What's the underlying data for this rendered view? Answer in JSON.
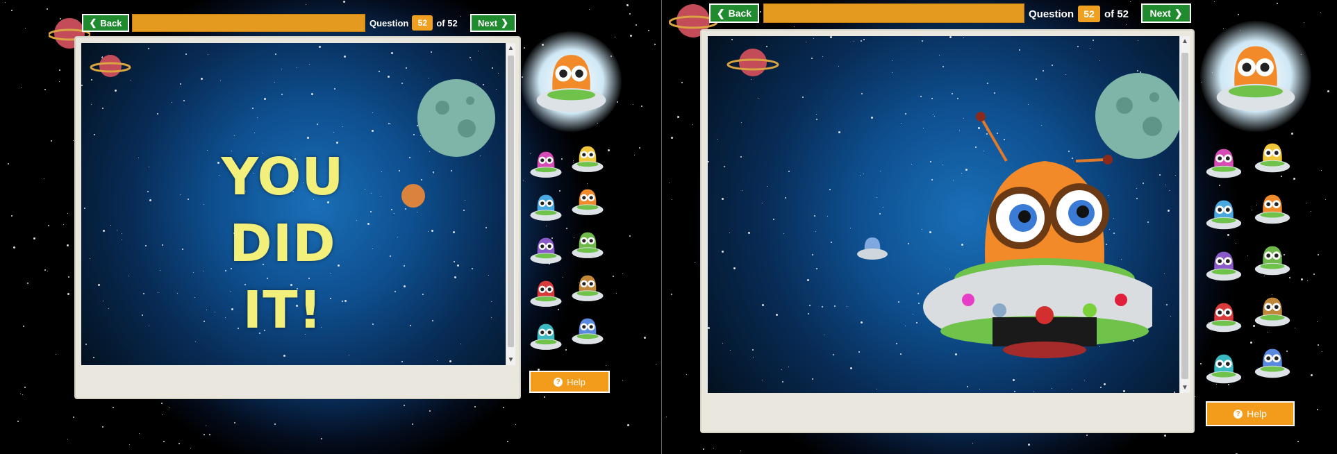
{
  "nav": {
    "back_label": "Back",
    "next_label": "Next",
    "question_word": "Question",
    "question_number": "52",
    "of_text": "of 52"
  },
  "celebration": {
    "line1": "YOU DID",
    "line2": "IT!"
  },
  "help_label": "Help",
  "icons": {
    "back": "chevron-left-icon",
    "next": "chevron-right-icon",
    "help": "question-circle-icon"
  },
  "colors": {
    "nav_button": "#1f8a2e",
    "progress_bar": "#e49a1f",
    "help_button": "#f39c1b",
    "title_text": "#f2f07a"
  }
}
